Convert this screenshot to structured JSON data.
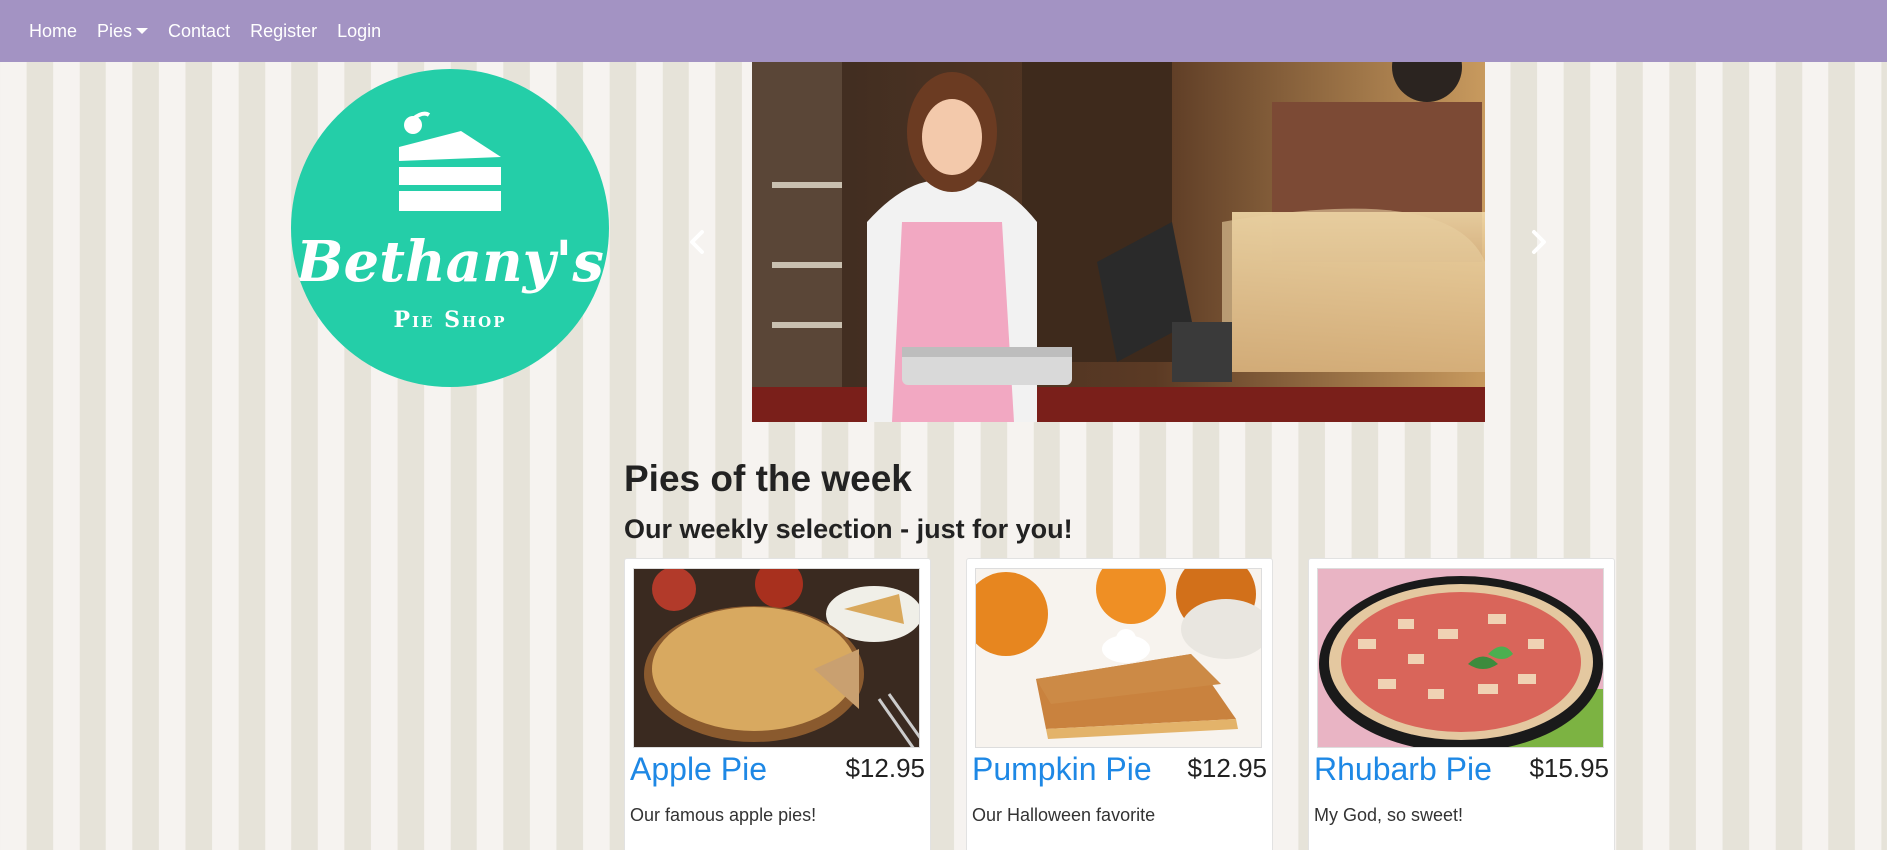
{
  "nav": {
    "items": [
      {
        "label": "Home"
      },
      {
        "label": "Pies",
        "has_dropdown": true
      },
      {
        "label": "Contact"
      },
      {
        "label": "Register"
      },
      {
        "label": "Login"
      }
    ],
    "background_color": "#a393c3"
  },
  "logo": {
    "name": "Bethany's",
    "subtitle": "Pie Shop",
    "color": "#24cea8"
  },
  "carousel": {
    "prev_icon": "chevron-left-icon",
    "next_icon": "chevron-right-icon"
  },
  "section": {
    "title": "Pies of the week",
    "subtitle": "Our weekly selection - just for you!"
  },
  "pies": [
    {
      "name": "Apple Pie",
      "price": "$12.95",
      "description": "Our famous apple pies!"
    },
    {
      "name": "Pumpkin Pie",
      "price": "$12.95",
      "description": "Our Halloween favorite"
    },
    {
      "name": "Rhubarb Pie",
      "price": "$15.95",
      "description": "My God, so sweet!"
    }
  ],
  "colors": {
    "link": "#1e88e5",
    "stripe_light": "#f6f3f0",
    "stripe_dark": "#e6e3d9"
  }
}
